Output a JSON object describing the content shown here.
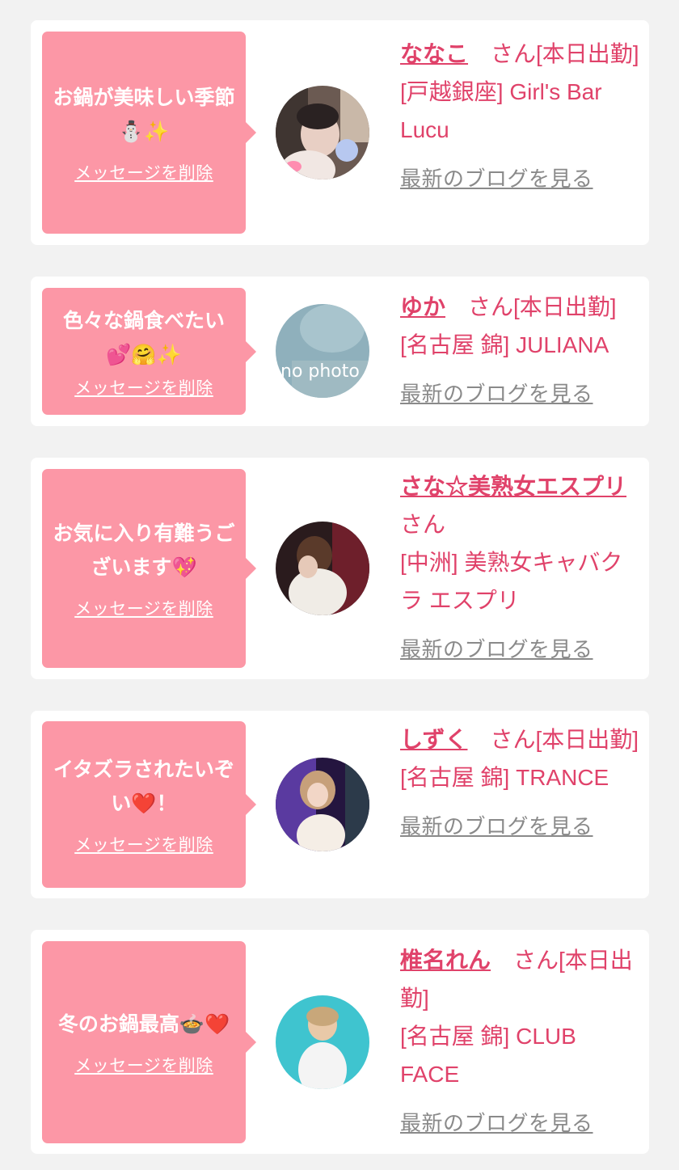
{
  "delete_label": "メッセージを削除",
  "blog_label": "最新のブログを見る",
  "colors": {
    "bubble": "#fc97a6",
    "accent": "#e0426a",
    "link_gray": "#8a8a8a",
    "background": "#f2f2f2"
  },
  "entries": [
    {
      "message": "お鍋が美味しい季節",
      "message_icons": [
        "⛄",
        "✨"
      ],
      "name": "ななこ",
      "name_suffix": "さん[本日出勤]",
      "shop": "[戸越銀座] Girl's Bar Lucu",
      "avatar": "photo"
    },
    {
      "message": "色々な鍋食べたい",
      "message_icons": [
        "💕",
        "🤗",
        "✨"
      ],
      "name": "ゆか",
      "name_suffix": "さん[本日出勤]",
      "shop": "[名古屋 錦] JULIANA",
      "avatar": "no photo"
    },
    {
      "message": "お気に入り有難うございます",
      "message_icons": [
        "💖"
      ],
      "name": "さな☆美熟女エスプリ",
      "name_suffix": "さん",
      "shop": "[中洲] 美熟女キャバクラ エスプリ",
      "avatar": "photo"
    },
    {
      "message": "イタズラされたいぞい",
      "message_icons": [
        "❤️",
        "！"
      ],
      "name": "しずく",
      "name_suffix": "さん[本日出勤]",
      "shop": "[名古屋 錦] TRANCE",
      "avatar": "photo"
    },
    {
      "message": "冬のお鍋最高",
      "message_icons": [
        "🍲",
        "❤️"
      ],
      "name": "椎名れん",
      "name_suffix": "さん[本日出勤]",
      "shop": "[名古屋 錦] CLUB FACE",
      "avatar": "photo"
    }
  ]
}
